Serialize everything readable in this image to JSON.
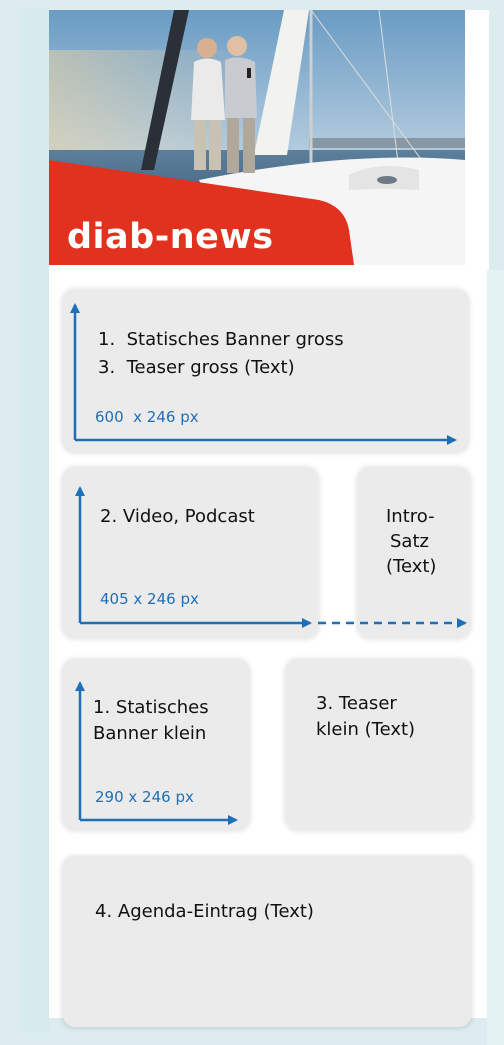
{
  "header": {
    "brand": "diab-news"
  },
  "blocks": {
    "b1": {
      "item1": "1.  Statisches Banner gross",
      "item2": "3.  Teaser gross (Text)",
      "size": "600  x 246 px"
    },
    "b2": {
      "label": "2. Video, Podcast",
      "size": "405 x 246 px"
    },
    "b3": {
      "line1": "Intro-",
      "line2": "Satz",
      "line3": "(Text)"
    },
    "b4": {
      "line1": "1. Statisches",
      "line2": "Banner klein",
      "size": "290 x 246 px"
    },
    "b5": {
      "line1": "3. Teaser",
      "line2": "klein (Text)"
    },
    "b6": {
      "label": "4. Agenda-Eintrag (Text)"
    }
  },
  "colors": {
    "arrow": "#1f6fb8",
    "banner_red": "#e0321e",
    "box": "#ebebeb"
  }
}
